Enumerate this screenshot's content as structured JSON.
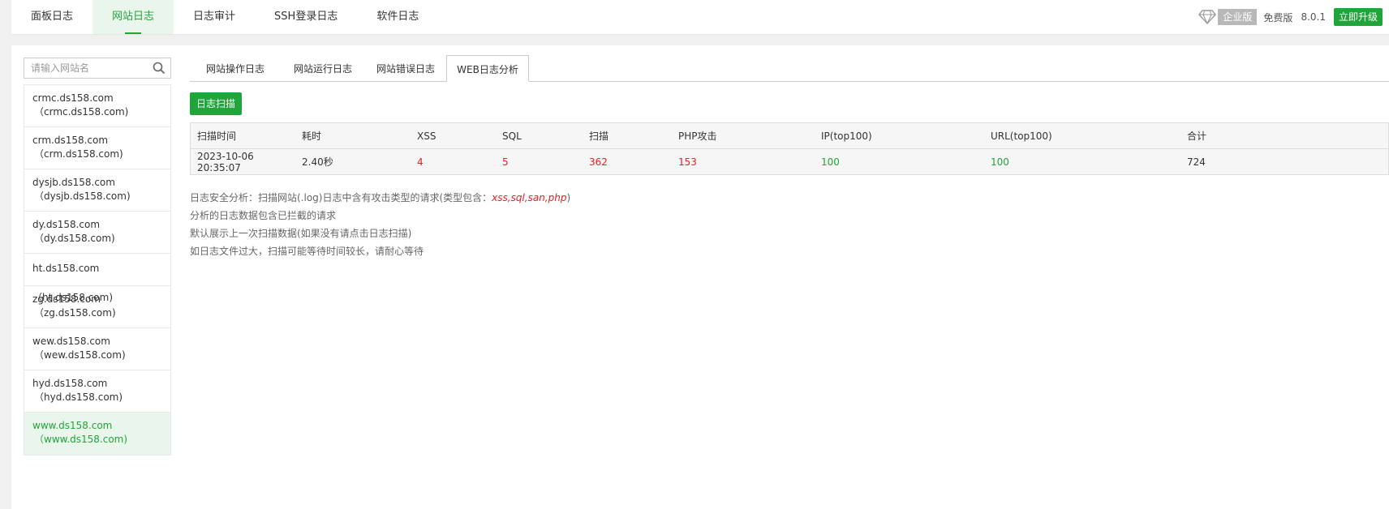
{
  "topnav": {
    "items": [
      {
        "label": "面板日志",
        "active": false
      },
      {
        "label": "网站日志",
        "active": true
      },
      {
        "label": "日志审计",
        "active": false
      },
      {
        "label": "SSH登录日志",
        "active": false
      },
      {
        "label": "软件日志",
        "active": false
      }
    ],
    "enterprise_label": "企业版",
    "free_label": "免费版",
    "version": "8.0.1",
    "upgrade_label": "立即升级"
  },
  "sidebar": {
    "search_placeholder": "请输入网站名",
    "sites": [
      {
        "name": "crmc.ds158.com",
        "alias": "（crmc.ds158.com)",
        "active": false
      },
      {
        "name": "crm.ds158.com",
        "alias": "（crm.ds158.com)",
        "active": false
      },
      {
        "name": "dysjb.ds158.com",
        "alias": "（dysjb.ds158.com)",
        "active": false
      },
      {
        "name": "dy.ds158.com",
        "alias": "（dy.ds158.com)",
        "active": false
      },
      {
        "name": "ht.ds158.com（ht.ds158.com)",
        "alias": "",
        "active": false
      },
      {
        "name": "zg.ds158.com",
        "alias": "（zg.ds158.com)",
        "active": false
      },
      {
        "name": "wew.ds158.com",
        "alias": "（wew.ds158.com)",
        "active": false
      },
      {
        "name": "hyd.ds158.com",
        "alias": "（hyd.ds158.com)",
        "active": false
      },
      {
        "name": "www.ds158.com",
        "alias": "（www.ds158.com)",
        "active": true
      }
    ]
  },
  "tabs": [
    {
      "label": "网站操作日志",
      "active": false
    },
    {
      "label": "网站运行日志",
      "active": false
    },
    {
      "label": "网站错误日志",
      "active": false
    },
    {
      "label": "WEB日志分析",
      "active": true
    }
  ],
  "scan_button": "日志扫描",
  "table": {
    "headers": [
      "扫描时间",
      "耗时",
      "XSS",
      "SQL",
      "扫描",
      "PHP攻击",
      "IP(top100)",
      "URL(top100)",
      "合计"
    ],
    "row": {
      "time": "2023-10-06 20:35:07",
      "duration": "2.40秒",
      "xss": "4",
      "sql": "5",
      "scan": "362",
      "php": "153",
      "ip": "100",
      "url": "100",
      "total": "724"
    }
  },
  "notes": {
    "line1_prefix": "日志安全分析：扫描网站(.log)日志中含有攻击类型的请求(类型包含：",
    "line1_types": "xss,sql,san,php",
    "line1_suffix": ")",
    "line2": "分析的日志数据包含已拦截的请求",
    "line3": "默认展示上一次扫描数据(如果没有请点击日志扫描)",
    "line4": "如日志文件过大，扫描可能等待时间较长，请耐心等待"
  },
  "colors": {
    "accent": "#20a53a",
    "danger": "#e02222"
  }
}
